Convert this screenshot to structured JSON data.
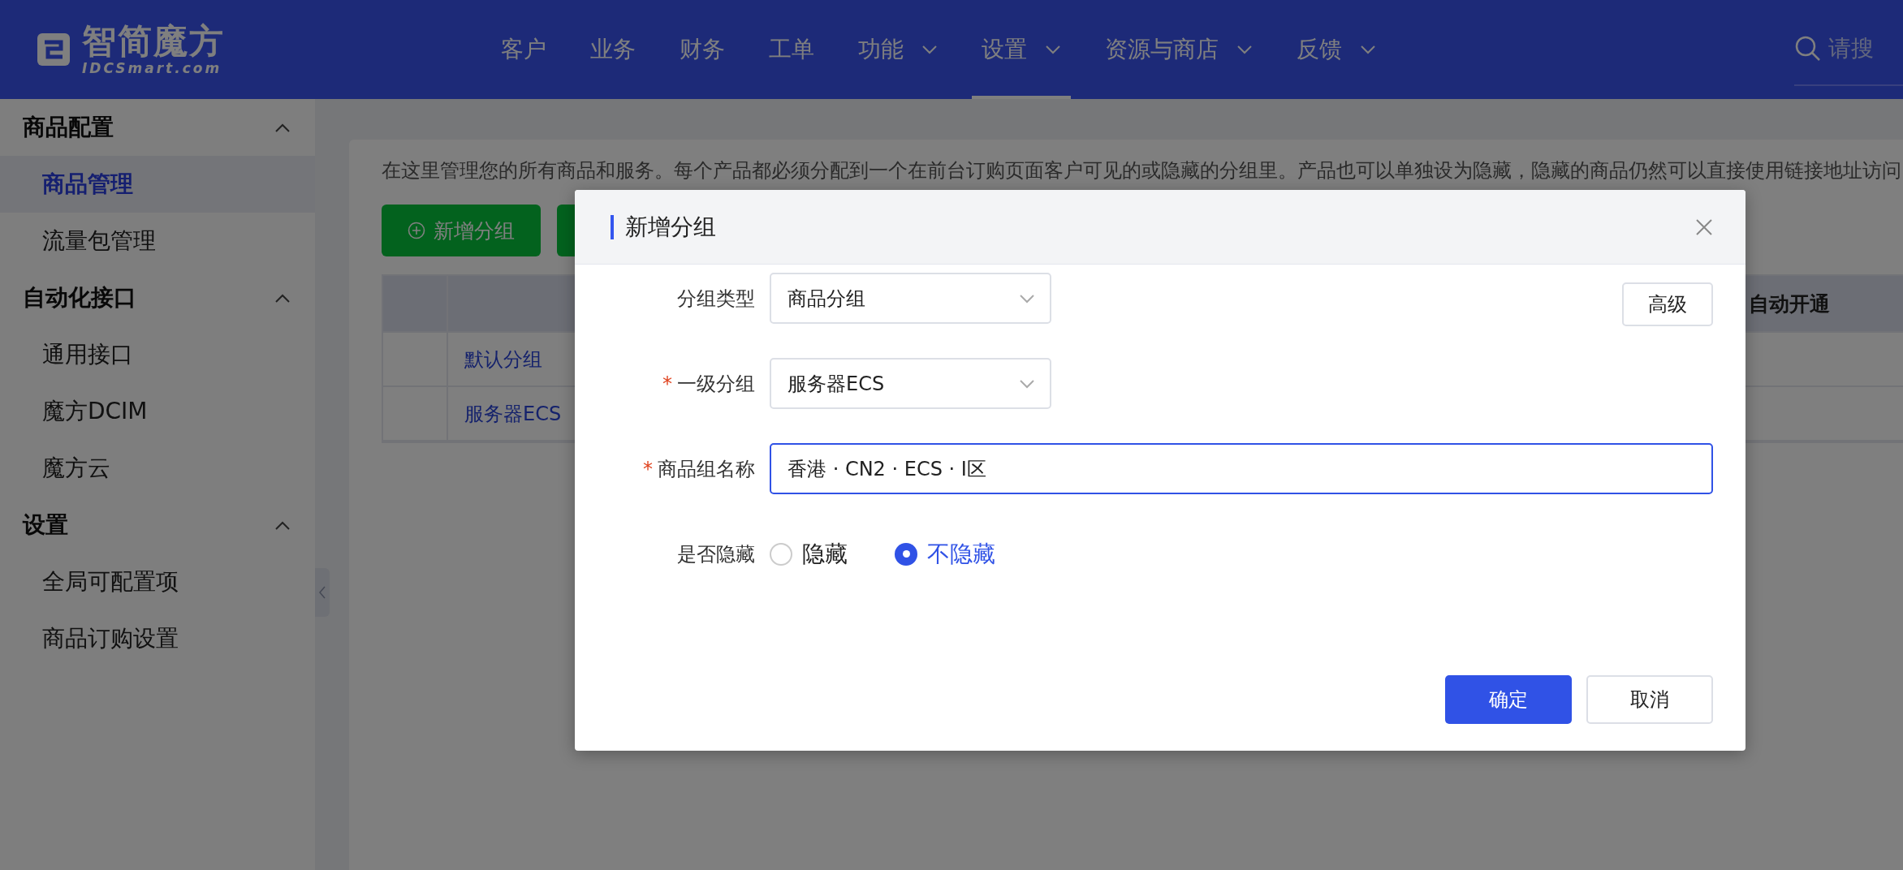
{
  "header": {
    "logo_text": "智简魔方",
    "logo_subtext": "IDCSmart.com",
    "nav": [
      {
        "label": "客户",
        "dropdown": false,
        "selected": false
      },
      {
        "label": "业务",
        "dropdown": false,
        "selected": false
      },
      {
        "label": "财务",
        "dropdown": false,
        "selected": false
      },
      {
        "label": "工单",
        "dropdown": false,
        "selected": false
      },
      {
        "label": "功能",
        "dropdown": true,
        "selected": false
      },
      {
        "label": "设置",
        "dropdown": true,
        "selected": true
      },
      {
        "label": "资源与商店",
        "dropdown": true,
        "selected": false
      },
      {
        "label": "反馈",
        "dropdown": true,
        "selected": false
      }
    ],
    "search": {
      "placeholder": "请搜"
    }
  },
  "sidebar": {
    "groups": [
      {
        "title": "商品配置",
        "expanded": true,
        "items": [
          {
            "label": "商品管理",
            "selected": true
          },
          {
            "label": "流量包管理",
            "selected": false
          }
        ]
      },
      {
        "title": "自动化接口",
        "expanded": true,
        "items": [
          {
            "label": "通用接口",
            "selected": false
          },
          {
            "label": "魔方DCIM",
            "selected": false
          },
          {
            "label": "魔方云",
            "selected": false
          }
        ]
      },
      {
        "title": "设置",
        "expanded": true,
        "items": [
          {
            "label": "全局可配置项",
            "selected": false
          },
          {
            "label": "商品订购设置",
            "selected": false
          }
        ]
      }
    ]
  },
  "main": {
    "description": "在这里管理您的所有商品和服务。每个产品都必须分配到一个在前台订购页面客户可见的或隐藏的分组里。产品也可以单独设为隐藏，隐藏的商品仍然可以直接使用链接地址访问",
    "add_button": "新增分组",
    "table": {
      "columns": [
        "自动开通"
      ],
      "rows": [
        {
          "name": "默认分组"
        },
        {
          "name": "服务器ECS"
        }
      ]
    }
  },
  "dialog": {
    "title": "新增分组",
    "advanced_button": "高级",
    "required_mark": "*",
    "fields": [
      {
        "kind": "select",
        "label": "分组类型",
        "required": false,
        "value": "商品分组"
      },
      {
        "kind": "select",
        "label": "一级分组",
        "required": true,
        "value": "服务器ECS"
      },
      {
        "kind": "text",
        "label": "商品组名称",
        "required": true,
        "value": "香港 · CN2 · ECS · Ⅰ区"
      },
      {
        "kind": "radio",
        "label": "是否隐藏",
        "required": false,
        "options": [
          {
            "label": "隐藏",
            "selected": false
          },
          {
            "label": "不隐藏",
            "selected": true
          }
        ]
      }
    ],
    "buttons": [
      {
        "label": "确定",
        "kind": "primary"
      },
      {
        "label": "取消",
        "kind": "default"
      }
    ]
  }
}
